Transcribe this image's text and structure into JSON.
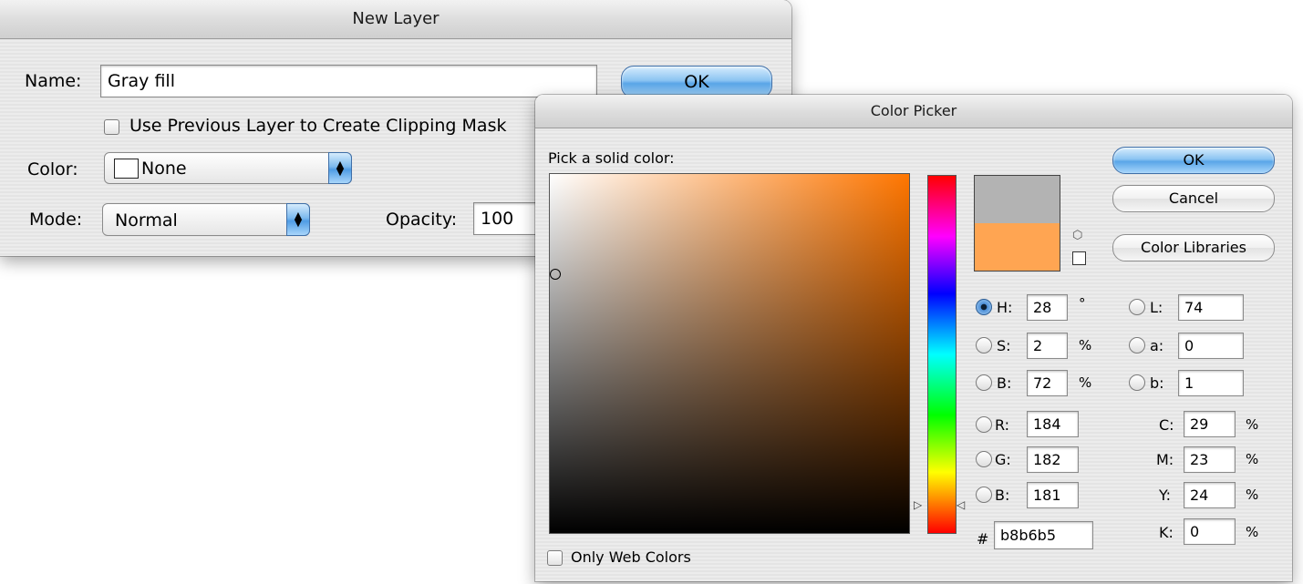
{
  "new_layer": {
    "title": "New Layer",
    "name_label": "Name:",
    "name_value": "Gray fill",
    "ok_label": "OK",
    "clipping_label": "Use Previous Layer to Create Clipping Mask",
    "color_label": "Color:",
    "color_value": "None",
    "mode_label": "Mode:",
    "mode_value": "Normal",
    "opacity_label": "Opacity:",
    "opacity_value": "100"
  },
  "color_picker": {
    "title": "Color Picker",
    "prompt": "Pick a solid color:",
    "ok_label": "OK",
    "cancel_label": "Cancel",
    "libraries_label": "Color Libraries",
    "new_color": "#ffa552",
    "current_color": "#b8b6b5",
    "web_colors_label": "Only Web Colors",
    "hex_label": "#",
    "hex_value": "b8b6b5",
    "fields": {
      "H": {
        "label": "H:",
        "value": "28",
        "unit": "°"
      },
      "S": {
        "label": "S:",
        "value": "2",
        "unit": "%"
      },
      "Bri": {
        "label": "B:",
        "value": "72",
        "unit": "%"
      },
      "R": {
        "label": "R:",
        "value": "184"
      },
      "G": {
        "label": "G:",
        "value": "182"
      },
      "Bl": {
        "label": "B:",
        "value": "181"
      },
      "L": {
        "label": "L:",
        "value": "74"
      },
      "a": {
        "label": "a:",
        "value": "0"
      },
      "b": {
        "label": "b:",
        "value": "1"
      },
      "C": {
        "label": "C:",
        "value": "29",
        "unit": "%"
      },
      "M": {
        "label": "M:",
        "value": "23",
        "unit": "%"
      },
      "Y": {
        "label": "Y:",
        "value": "24",
        "unit": "%"
      },
      "K": {
        "label": "K:",
        "value": "0",
        "unit": "%"
      }
    }
  }
}
